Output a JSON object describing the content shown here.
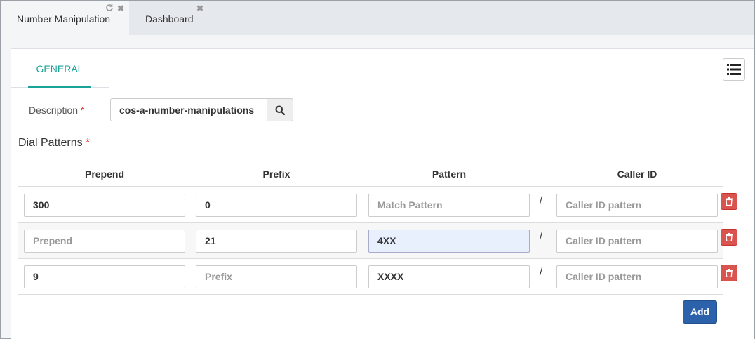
{
  "tabs": [
    {
      "label": "Number Manipulation",
      "active": true
    },
    {
      "label": "Dashboard",
      "active": false
    }
  ],
  "form": {
    "subtab": "GENERAL",
    "description_label": "Description",
    "required_mark": "*",
    "description_value": "cos-a-number-manipulations",
    "section_title": "Dial Patterns",
    "columns": [
      "Prepend",
      "Prefix",
      "Pattern",
      "Caller ID"
    ],
    "separator": "/",
    "rows": [
      {
        "prepend": {
          "text": "300",
          "placeholder": false
        },
        "prefix": {
          "text": "0",
          "placeholder": false
        },
        "pattern": {
          "text": "Match Pattern",
          "placeholder": true
        },
        "callerid": {
          "text": "Caller ID pattern",
          "placeholder": true
        }
      },
      {
        "prepend": {
          "text": "Prepend",
          "placeholder": true
        },
        "prefix": {
          "text": "21",
          "placeholder": false
        },
        "pattern": {
          "text": "4XX",
          "placeholder": false
        },
        "callerid": {
          "text": "Caller ID pattern",
          "placeholder": true
        }
      },
      {
        "prepend": {
          "text": "9",
          "placeholder": false
        },
        "prefix": {
          "text": "Prefix",
          "placeholder": true
        },
        "pattern": {
          "text": "XXXX",
          "placeholder": false
        },
        "callerid": {
          "text": "Caller ID pattern",
          "placeholder": true
        }
      }
    ],
    "add_label": "Add"
  },
  "icons": {
    "tab_refresh": "refresh-icon",
    "tab_close": "close-icon",
    "list": "list-icon",
    "search": "search-icon",
    "delete": "trash-icon"
  },
  "colors": {
    "accent": "#1aa39a",
    "primary": "#2b62ab",
    "danger": "#d9534f",
    "required": "#d9342b"
  }
}
